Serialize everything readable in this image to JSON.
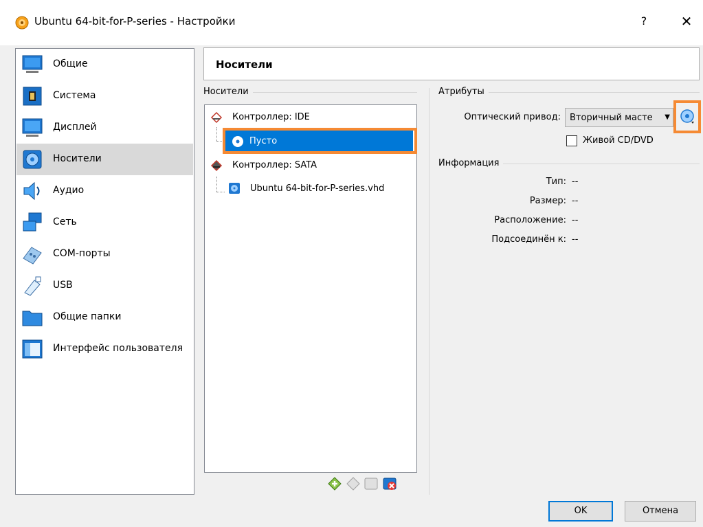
{
  "window": {
    "title": "Ubuntu 64-bit-for-P-series - Настройки",
    "help_label": "?",
    "close_label": "✕"
  },
  "sidebar": {
    "items": [
      {
        "label": "Общие",
        "icon": "general-icon"
      },
      {
        "label": "Система",
        "icon": "system-icon"
      },
      {
        "label": "Дисплей",
        "icon": "display-icon"
      },
      {
        "label": "Носители",
        "icon": "storage-icon",
        "selected": true
      },
      {
        "label": "Аудио",
        "icon": "audio-icon"
      },
      {
        "label": "Сеть",
        "icon": "network-icon"
      },
      {
        "label": "COM-порты",
        "icon": "serial-ports-icon"
      },
      {
        "label": "USB",
        "icon": "usb-icon"
      },
      {
        "label": "Общие папки",
        "icon": "shared-folders-icon"
      },
      {
        "label": "Интерфейс пользователя",
        "icon": "user-interface-icon"
      }
    ]
  },
  "page": {
    "title": "Носители"
  },
  "storage": {
    "group_label": "Носители",
    "tree": {
      "ide_controller": "Контроллер: IDE",
      "ide_empty": "Пусто",
      "sata_controller": "Контроллер: SATA",
      "sata_disk": "Ubuntu 64-bit-for-P-series.vhd"
    }
  },
  "attributes": {
    "group_label": "Атрибуты",
    "optical_drive_label": "Оптический привод:",
    "optical_drive_value": "Вторичный масте",
    "live_cd_label": "Живой CD/DVD",
    "live_cd_checked": false
  },
  "information": {
    "group_label": "Информация",
    "type_label": "Тип:",
    "type_value": "--",
    "size_label": "Размер:",
    "size_value": "--",
    "location_label": "Расположение:",
    "location_value": "--",
    "attached_label": "Подсоединён к:",
    "attached_value": "--"
  },
  "buttons": {
    "ok": "OK",
    "cancel": "Отмена"
  },
  "colors": {
    "selection": "#0078d7",
    "highlight_outline": "#f58a34"
  }
}
